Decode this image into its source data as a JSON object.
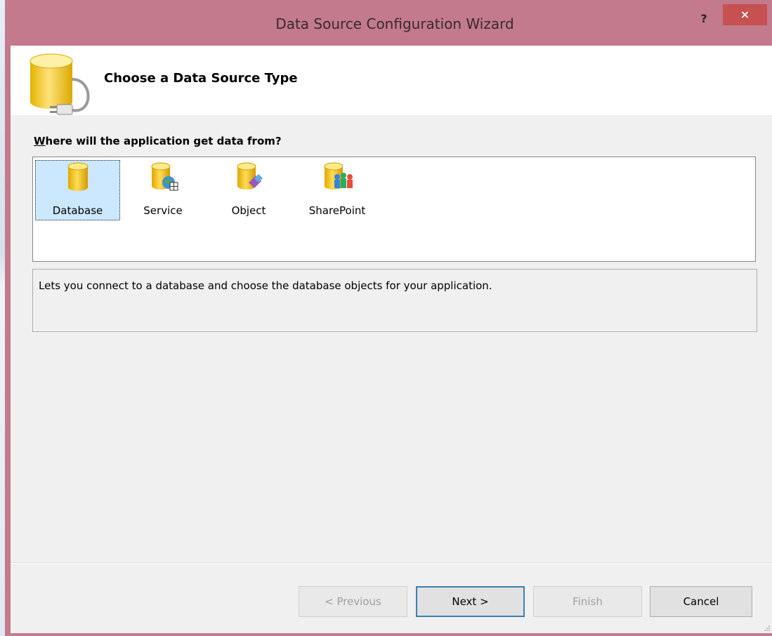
{
  "window": {
    "title": "Data Source Configuration Wizard",
    "help_label": "?",
    "close_label": "×"
  },
  "header": {
    "title": "Choose a Data Source Type",
    "icon": "database-plug-icon"
  },
  "prompt": {
    "label": "Where will the application get data from?",
    "mnemonic": "W"
  },
  "source_types": [
    {
      "label": "Database",
      "icon": "database-icon",
      "selected": true
    },
    {
      "label": "Service",
      "icon": "service-icon",
      "selected": false
    },
    {
      "label": "Object",
      "icon": "object-icon",
      "selected": false
    },
    {
      "label": "SharePoint",
      "icon": "sharepoint-icon",
      "selected": false
    }
  ],
  "description": "Lets you connect to a database and choose the database objects for your application.",
  "buttons": {
    "previous": "< Previous",
    "next": "Next >",
    "finish": "Finish",
    "cancel": "Cancel"
  },
  "colors": {
    "title_bar": "#c27a8c",
    "close_button": "#c75050",
    "selection": "#cce8ff",
    "db_gold": "#f2c400"
  }
}
